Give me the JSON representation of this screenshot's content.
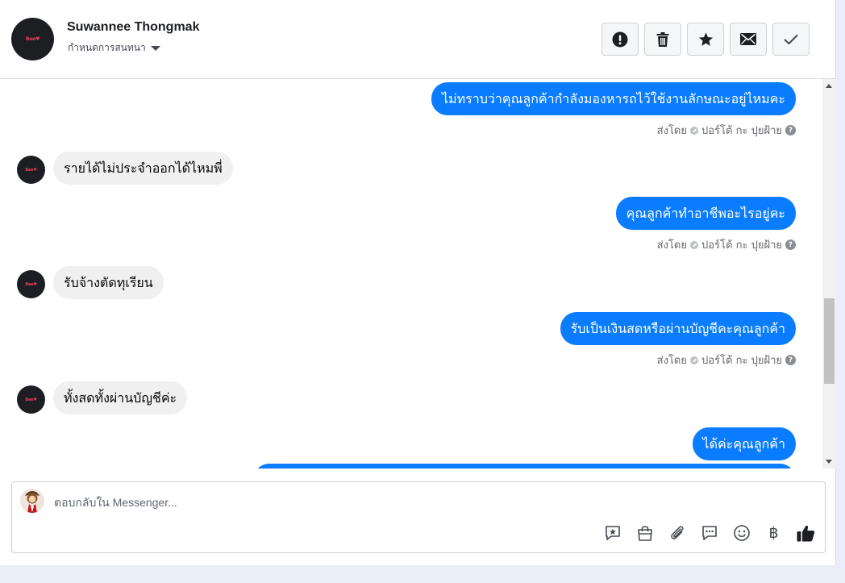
{
  "header": {
    "contact_name": "Suwannee Thongmak",
    "assign_label": "กำหนดการสนทนา",
    "avatar_text": "Bee♥",
    "actions": [
      {
        "name": "mark-spam-button",
        "icon": "exclamation-circle-icon"
      },
      {
        "name": "delete-button",
        "icon": "trash-icon"
      },
      {
        "name": "star-button",
        "icon": "star-icon"
      },
      {
        "name": "mark-unread-button",
        "icon": "envelope-icon"
      },
      {
        "name": "mark-done-button",
        "icon": "check-icon"
      }
    ]
  },
  "messages": {
    "m1": {
      "text": "ไม่ทราบว่าคุณลูกค้ากำลังมองหารถไว้ใช้งานลักษณะอยู่ไหมคะ"
    },
    "meta1": {
      "sent_by": "ส่งโดย",
      "sender": "ปอร์โต้ กะ ปุยฝ้าย"
    },
    "m2": {
      "text": "รายได้ไม่ประจำออกได้ไหมพี่"
    },
    "m3": {
      "text": "คุณลูกค้าทำอาชีพอะไรอยู่คะ"
    },
    "meta3": {
      "sent_by": "ส่งโดย",
      "sender": "ปอร์โต้ กะ ปุยฝ้าย"
    },
    "m4": {
      "text": "รับจ้างตัดทุเรียน"
    },
    "m5": {
      "text": "รับเป็นเงินสดหรือผ่านบัญชีคะคุณลูกค้า"
    },
    "meta5": {
      "sent_by": "ส่งโดย",
      "sender": "ปอร์โต้ กะ ปุยฝ้าย"
    },
    "m6": {
      "text": "ทั้งสดทั้งผ่านบัญชีค่ะ"
    },
    "m7": {
      "text": "ได้ค่ะคุณลูกค้า"
    }
  },
  "composer": {
    "placeholder": "ตอบกลับใน Messenger...",
    "tools": [
      "saved-reply-icon",
      "shopping-bag-icon",
      "paperclip-icon",
      "chat-bubble-icon",
      "emoji-icon",
      "baht-icon",
      "thumbs-up-icon"
    ],
    "currency_symbol": "฿"
  },
  "colors": {
    "outgoing_bubble": "#0a7cff",
    "incoming_bubble": "#f0f0f0"
  }
}
